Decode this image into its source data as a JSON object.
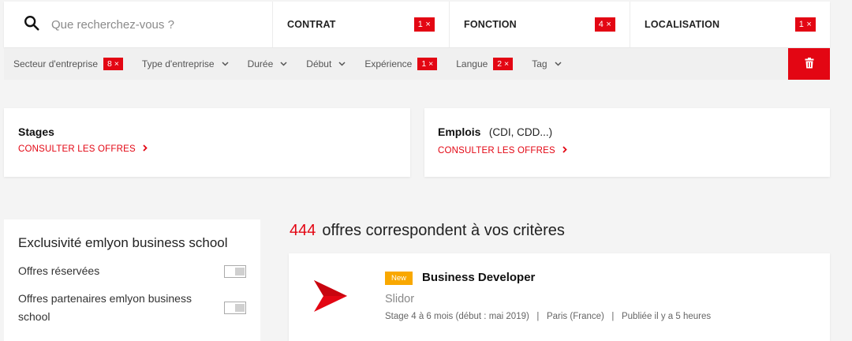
{
  "search": {
    "placeholder": "Que recherchez-vous ?"
  },
  "filters": [
    {
      "label": "CONTRAT",
      "count": "1 ×"
    },
    {
      "label": "FONCTION",
      "count": "4 ×"
    },
    {
      "label": "LOCALISATION",
      "count": "1 ×"
    }
  ],
  "subfilters": [
    {
      "label": "Secteur d'entreprise",
      "badge": "8 ×"
    },
    {
      "label": "Type d'entreprise",
      "chevron": "⌄"
    },
    {
      "label": "Durée",
      "chevron": "⌄"
    },
    {
      "label": "Début",
      "chevron": "⌄"
    },
    {
      "label": "Expérience",
      "badge": "1 ×"
    },
    {
      "label": "Langue",
      "badge": "2 ×"
    },
    {
      "label": "Tag",
      "chevron": "⌄"
    }
  ],
  "cards": {
    "stages": {
      "title": "Stages",
      "link": "CONSULTER LES OFFRES"
    },
    "emplois": {
      "title": "Emplois",
      "subtitle": "(CDI, CDD...)",
      "link": "CONSULTER LES OFFRES"
    }
  },
  "sidebar": {
    "title": "Exclusivité emlyon business school",
    "options": [
      "Offres réservées",
      "Offres partenaires emlyon business school"
    ]
  },
  "results": {
    "count": "444",
    "text": "offres correspondent à vos critères"
  },
  "offer": {
    "badge": "New",
    "title": "Business Developer",
    "company": "Slidor",
    "meta": "Stage 4 à 6 mois (début : mai 2019)   |   Paris (France)   |   Publiée il y a 5 heures"
  },
  "colors": {
    "accent": "#e30613",
    "new_badge": "#f9a800"
  },
  "icons": [
    "search-icon",
    "chevron-down-icon",
    "trash-icon",
    "chevron-right-icon",
    "company-logo"
  ]
}
